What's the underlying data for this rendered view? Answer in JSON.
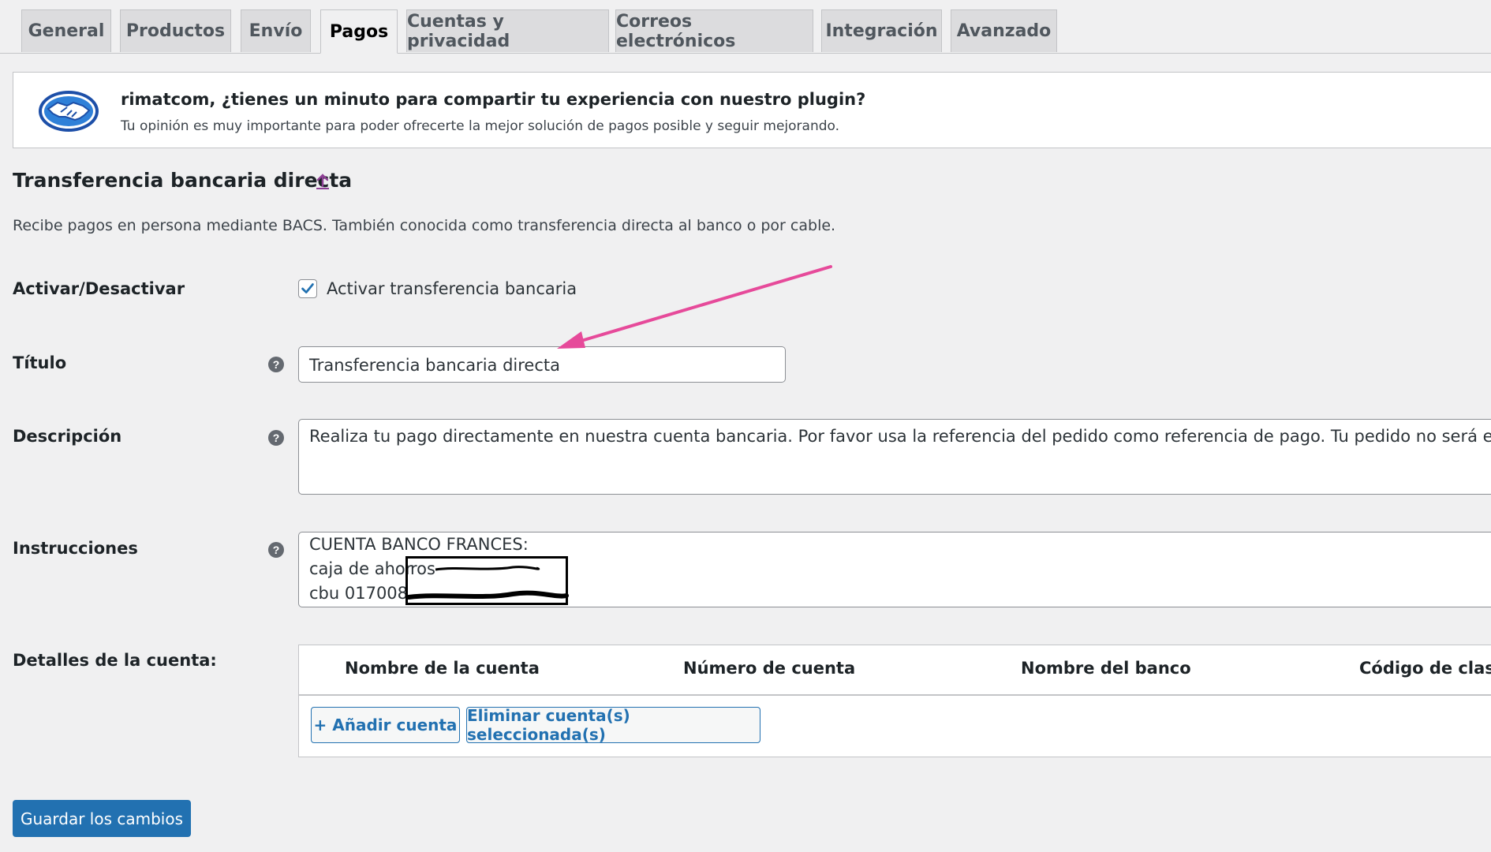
{
  "tabs": [
    {
      "label": "General"
    },
    {
      "label": "Productos"
    },
    {
      "label": "Envío"
    },
    {
      "label": "Pagos"
    },
    {
      "label": "Cuentas y privacidad"
    },
    {
      "label": "Correos electrónicos"
    },
    {
      "label": "Integración"
    },
    {
      "label": "Avanzado"
    }
  ],
  "notice": {
    "title": "rimatcom, ¿tienes un minuto para compartir tu experiencia con nuestro plugin?",
    "text": "Tu opinión es muy importante para poder ofrecerte la mejor solución de pagos posible y seguir mejorando.",
    "icon": "handshake-icon"
  },
  "section": {
    "title": "Transferencia bancaria directa",
    "description": "Recibe pagos en persona mediante BACS. También conocida como transferencia directa al banco o por cable."
  },
  "fields": {
    "enable_label": "Activar/Desactivar",
    "enable_checkbox_label": "Activar transferencia bancaria",
    "enable_checked": true,
    "title_label": "Título",
    "title_value": "Transferencia bancaria directa",
    "description_label": "Descripción",
    "description_value": "Realiza tu pago directamente en nuestra cuenta bancaria. Por favor usa la referencia del pedido como referencia de pago. Tu pedido no será enviado h",
    "instructions_label": "Instrucciones",
    "instructions_lines": [
      "CUENTA BANCO FRANCES:",
      "caja de ahor",
      "cbu 017008"
    ],
    "instructions_hidden": [
      "ros",
      ""
    ],
    "account_details_label": "Detalles de la cuenta:"
  },
  "accounts": {
    "columns": [
      "Nombre de la cuenta",
      "Número de cuenta",
      "Nombre del banco",
      "Código de clasif"
    ],
    "add_button": "+ Añadir cuenta",
    "remove_button": "Eliminar cuenta(s) seleccionada(s)"
  },
  "save_button": "Guardar los cambios",
  "colors": {
    "accent": "#2271b1",
    "annotation_arrow": "#e64a9a",
    "link_purple": "#8e3f95"
  }
}
